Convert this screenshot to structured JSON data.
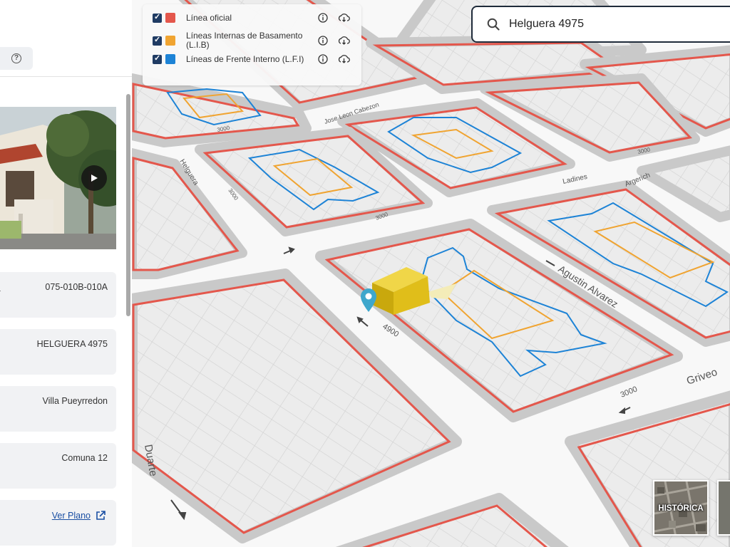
{
  "sidebar": {
    "help_icon": "question-circle-icon",
    "photo": {
      "play_icon": "play-icon"
    },
    "fields": [
      {
        "label": "a",
        "value": "075-010B-010A"
      },
      {
        "value": "HELGUERA 4975"
      },
      {
        "value": "Villa Pueyrredon"
      },
      {
        "value": "Comuna 12"
      }
    ],
    "plan_link": {
      "label": "Ver Plano",
      "icon": "external-link-icon"
    }
  },
  "layers": [
    {
      "label": "Línea oficial",
      "color": "#e4574c",
      "checked": true
    },
    {
      "label": "Líneas Internas de Basamento (L.I.B)",
      "color": "#f0a431",
      "checked": true
    },
    {
      "label": "Líneas de Frente Interno (L.F.I)",
      "color": "#1d83d6",
      "checked": true
    }
  ],
  "layer_icons": {
    "info": "info-icon",
    "download": "cloud-download-icon"
  },
  "search": {
    "value": "Helguera 4975",
    "icon": "search-icon"
  },
  "map": {
    "streets": [
      "Jose Leon Cabezon",
      "Helguera",
      "Ladines",
      "Argerich",
      "Agustin Alvarez",
      "Griveo",
      "Duarte"
    ],
    "numbers": [
      "3000",
      "3000",
      "3000",
      "3000",
      "4900",
      "3000"
    ],
    "marker_icon": "map-pin-icon",
    "colors": {
      "official": "#e4574c",
      "lib": "#f0a431",
      "lfi": "#1d83d6",
      "building": "#e8c515"
    }
  },
  "basemaps": [
    {
      "label": "HISTÓRICA"
    }
  ]
}
